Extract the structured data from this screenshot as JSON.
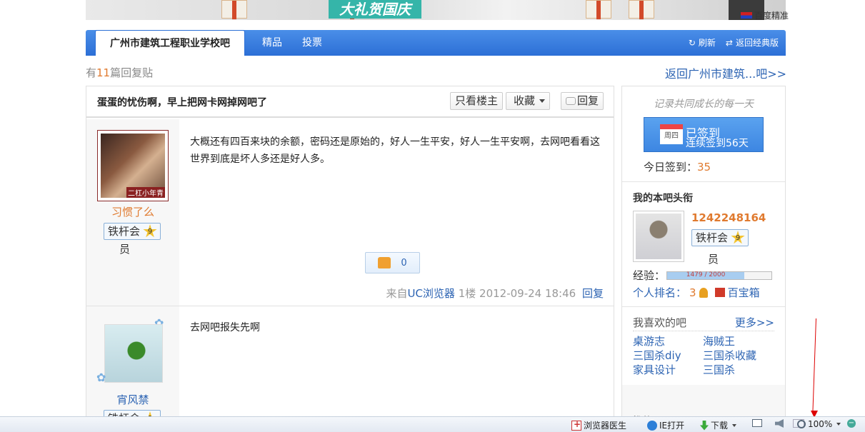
{
  "ad": {
    "banner_text": "大礼贺国庆",
    "baidu": "百度精准"
  },
  "nav": {
    "active_tab": "广州市建筑工程职业学校吧",
    "tabs": [
      "精品",
      "投票"
    ],
    "refresh": "刷新",
    "classic": "返回经典版"
  },
  "sub": {
    "reply_prefix": "有",
    "reply_num": "11",
    "reply_suffix": "篇回复贴",
    "back": "返回广州市建筑...吧>>"
  },
  "thread": {
    "title": "蛋蛋的忧伤啊，早上把网卡网掉网吧了",
    "only_op": "只看楼主",
    "collect": "收藏",
    "reply": "回复"
  },
  "posts": [
    {
      "avatar_tag": "二杠小年青",
      "username": "习惯了么",
      "badge": "铁杆会",
      "badge_tail": "员",
      "level": "9",
      "content": "大概还有四百来块的余额，密码还是原始的，好人一生平安，好人一生平安啊，去网吧看看这世界到底是坏人多还是好人多。",
      "likes": "0",
      "from": "来自",
      "source": "UC浏览器",
      "floor": "1楼",
      "time": "2012-09-24 18:46",
      "reply": "回复"
    },
    {
      "username": "宵风禁",
      "badge": "铁杆会",
      "level": "9",
      "content": "去网吧报失先啊"
    }
  ],
  "sidebar": {
    "slogan": "记录共同成长的每一天",
    "weekday": "周四",
    "signed": "已签到",
    "streak": "连续签到56天",
    "today_label": "今日签到：",
    "today_num": "35",
    "title_head": "我的本吧头衔",
    "my_id": "1242248164",
    "badge": "铁杆会",
    "badge_tail": "员",
    "level": "9",
    "exp_label": "经验：",
    "exp_text": "1479 / 2000",
    "exp_fraction": 0.7395,
    "rank_label": "个人排名：",
    "rank_num": "3",
    "treasure": "百宝箱",
    "fav_head": "我喜欢的吧",
    "more": "更多>>",
    "favs": [
      "桌游志",
      "海贼王",
      "三国杀diy",
      "三国杀收藏",
      "家具设计",
      "三国杀"
    ],
    "recommend": "推荐区"
  },
  "statusbar": {
    "doctor": "浏览器医生",
    "ie": "IE打开",
    "download": "下载",
    "zoom": "100%"
  }
}
